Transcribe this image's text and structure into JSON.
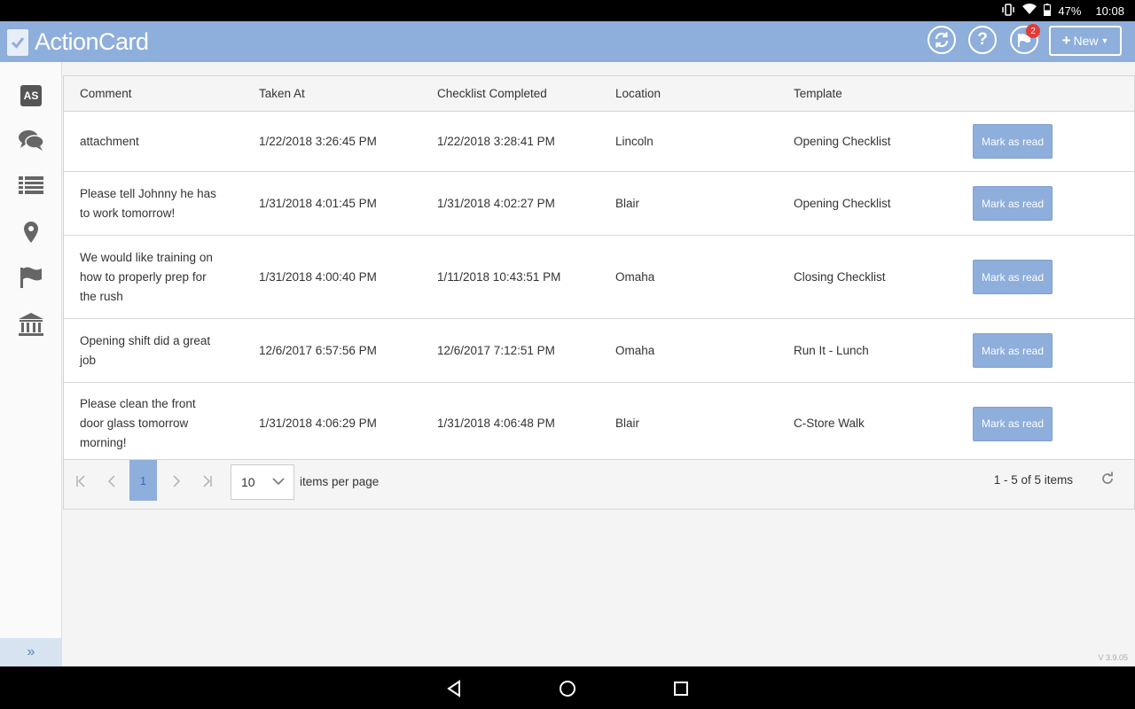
{
  "status_bar": {
    "battery": "47%",
    "time": "10:08"
  },
  "header": {
    "app_name": "ActionCard",
    "notification_count": "2",
    "new_button": "New"
  },
  "sidebar": {
    "avatar_initials": "AS",
    "items": [
      "comments-icon",
      "list-icon",
      "location-icon",
      "flag-icon",
      "bank-icon"
    ]
  },
  "table": {
    "columns": [
      "Comment",
      "Taken At",
      "Checklist Completed",
      "Location",
      "Template",
      ""
    ],
    "rows": [
      {
        "comment": "attachment",
        "taken_at": "1/22/2018 3:26:45 PM",
        "completed": "1/22/2018 3:28:41 PM",
        "location": "Lincoln",
        "template": "Opening Checklist",
        "action": "Mark as read"
      },
      {
        "comment": "Please tell Johnny he has to work tomorrow!",
        "taken_at": "1/31/2018 4:01:45 PM",
        "completed": "1/31/2018 4:02:27 PM",
        "location": "Blair",
        "template": "Opening Checklist",
        "action": "Mark as read"
      },
      {
        "comment": "We would like training on how to properly prep for the rush",
        "taken_at": "1/31/2018 4:00:40 PM",
        "completed": "1/11/2018 10:43:51 PM",
        "location": "Omaha",
        "template": "Closing Checklist",
        "action": "Mark as read"
      },
      {
        "comment": "Opening shift did a great job",
        "taken_at": "12/6/2017 6:57:56 PM",
        "completed": "12/6/2017 7:12:51 PM",
        "location": "Omaha",
        "template": "Run It - Lunch",
        "action": "Mark as read"
      },
      {
        "comment": "Please clean the front door glass tomorrow morning!",
        "taken_at": "1/31/2018 4:06:29 PM",
        "completed": "1/31/2018 4:06:48 PM",
        "location": "Blair",
        "template": "C-Store Walk",
        "action": "Mark as read"
      }
    ]
  },
  "pager": {
    "current_page": "1",
    "page_size": "10",
    "items_per_page_label": "items per page",
    "info": "1 - 5 of 5 items"
  },
  "version": "V 3.9.05",
  "colors": {
    "brand": "#8eaedb",
    "badge": "#e53935"
  }
}
